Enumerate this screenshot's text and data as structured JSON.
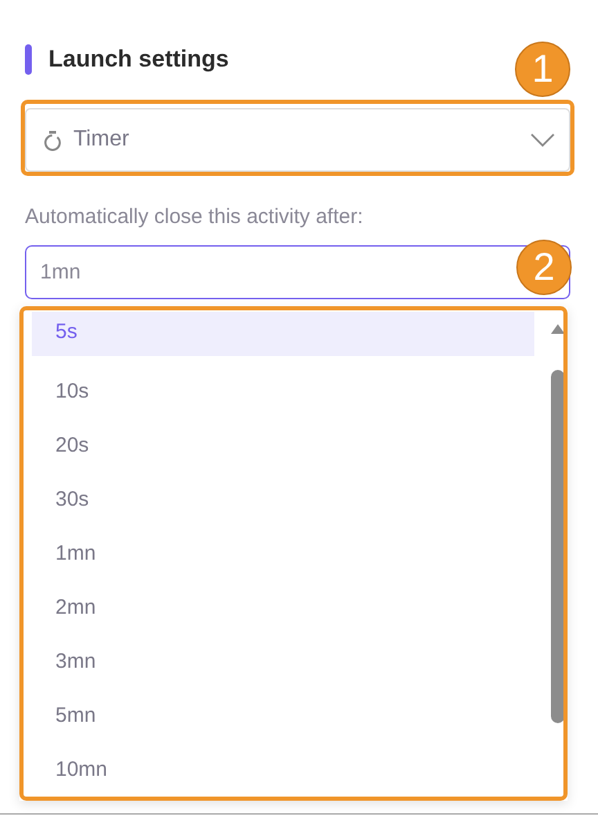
{
  "heading": "Launch settings",
  "mode_select": {
    "value": "Timer"
  },
  "duration_field": {
    "label": "Automatically close this activity after:",
    "value": "1mn"
  },
  "duration_options": [
    {
      "label": "5s",
      "selected": true
    },
    {
      "label": "10s",
      "selected": false
    },
    {
      "label": "20s",
      "selected": false
    },
    {
      "label": "30s",
      "selected": false
    },
    {
      "label": "1mn",
      "selected": false
    },
    {
      "label": "2mn",
      "selected": false
    },
    {
      "label": "3mn",
      "selected": false
    },
    {
      "label": "5mn",
      "selected": false
    },
    {
      "label": "10mn",
      "selected": false
    }
  ],
  "annotations": [
    {
      "number": "1"
    },
    {
      "number": "2"
    }
  ]
}
